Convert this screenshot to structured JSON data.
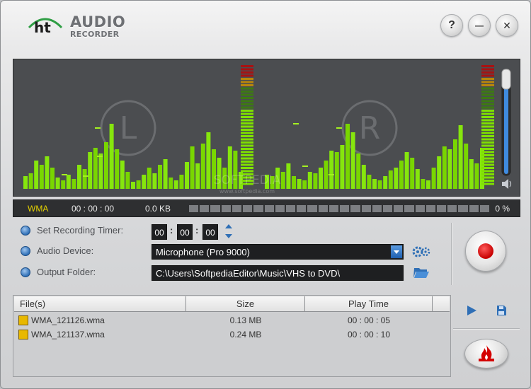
{
  "app": {
    "logo_mark": "ht",
    "logo_line1": "AUDIO",
    "logo_line2": "RECORDER"
  },
  "window_controls": {
    "help": "?",
    "minimize": "—",
    "close": "✕"
  },
  "visualizer": {
    "left_channel": "L",
    "right_channel": "R",
    "watermark": "SOFTPEDIA",
    "watermark_url": "www.softpedia.com",
    "volume_level": 0.92
  },
  "status": {
    "format": "WMA",
    "elapsed": "00 : 00 : 00",
    "size": "0.0 KB",
    "progress_percent": 0,
    "percent_label": "0 %"
  },
  "settings": {
    "timer_label": "Set Recording Timer:",
    "timer_hours": "00",
    "timer_minutes": "00",
    "timer_seconds": "00",
    "device_label": "Audio Device:",
    "device_value": "Microphone (Pro 9000)",
    "folder_label": "Output Folder:",
    "folder_value": "C:\\Users\\SoftpediaEditor\\Music\\VHS to DVD\\"
  },
  "file_list": {
    "columns": [
      "File(s)",
      "Size",
      "Play Time"
    ],
    "rows": [
      {
        "file": "WMA_121126.wma",
        "size": "0.13 MB",
        "time": "00 : 00 : 05"
      },
      {
        "file": "WMA_121137.wma",
        "size": "0.24 MB",
        "time": "00 : 00 : 10"
      }
    ]
  },
  "colors": {
    "accent_green": "#7fe000",
    "format_yellow": "#e5d200",
    "record_red": "#d40000",
    "ht_green": "#2f9e44"
  }
}
